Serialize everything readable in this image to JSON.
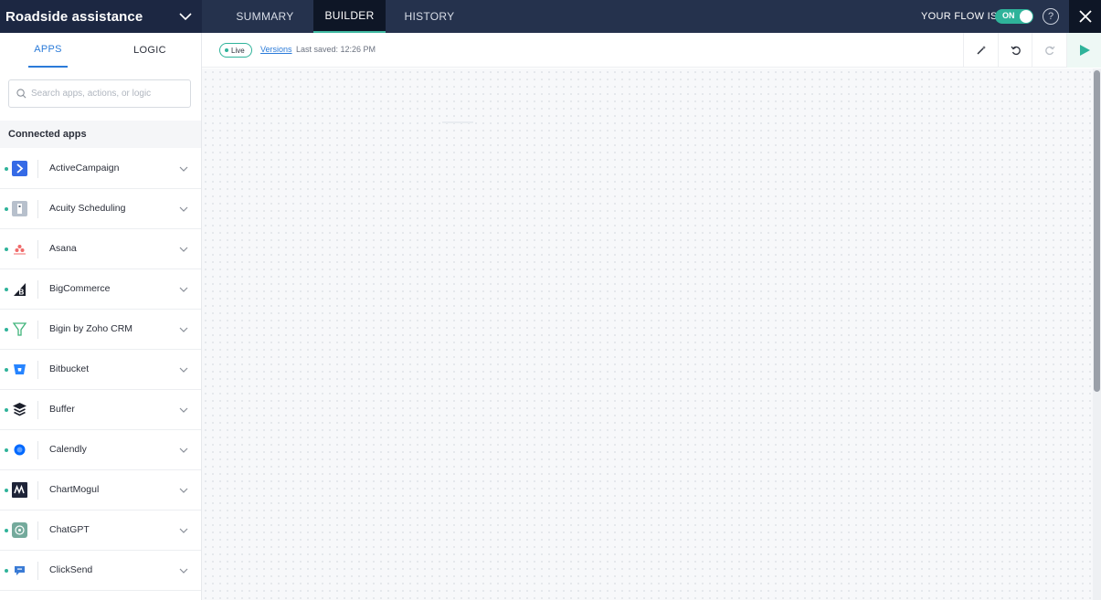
{
  "flow": {
    "name": "Roadside assistance"
  },
  "tabs": [
    {
      "label": "SUMMARY"
    },
    {
      "label": "BUILDER"
    },
    {
      "label": "HISTORY"
    }
  ],
  "status": {
    "label": "YOUR FLOW IS",
    "toggle": "ON",
    "toggle_on": true
  },
  "help": {
    "symbol": "?"
  },
  "sidebar": {
    "tabs": [
      {
        "label": "APPS"
      },
      {
        "label": "LOGIC"
      }
    ],
    "search": {
      "placeholder": "Search apps, actions, or logic"
    },
    "section_title": "Connected apps",
    "apps": [
      {
        "label": "ActiveCampaign",
        "icon": "activecampaign-logo"
      },
      {
        "label": "Acuity Scheduling",
        "icon": "acuity-scheduling-logo"
      },
      {
        "label": "Asana",
        "icon": "asana-logo"
      },
      {
        "label": "BigCommerce",
        "icon": "bigcommerce-logo"
      },
      {
        "label": "Bigin by Zoho CRM",
        "icon": "bigin-logo"
      },
      {
        "label": "Bitbucket",
        "icon": "bitbucket-logo"
      },
      {
        "label": "Buffer",
        "icon": "buffer-logo"
      },
      {
        "label": "Calendly",
        "icon": "calendly-logo"
      },
      {
        "label": "ChartMogul",
        "icon": "chartmogul-logo"
      },
      {
        "label": "ChatGPT",
        "icon": "chatgpt-logo"
      },
      {
        "label": "ClickSend",
        "icon": "clicksend-logo"
      }
    ]
  },
  "toolbar": {
    "live": "Live",
    "versions": "Versions",
    "last_saved": "Last saved: 12:26 PM"
  },
  "colors": {
    "topbar": "#25324d",
    "accent": "#2fb39a",
    "link": "#2b7bd9"
  }
}
